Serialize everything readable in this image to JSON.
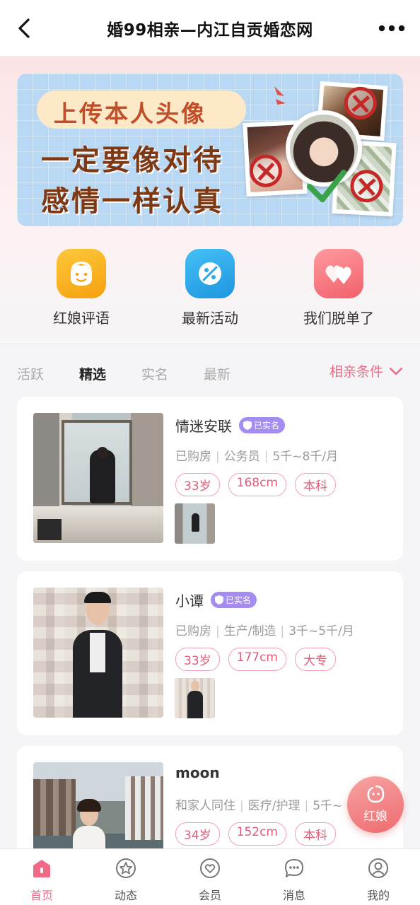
{
  "header": {
    "title": "婚99相亲—内江自贡婚恋网"
  },
  "banner": {
    "line1": "上传本人头像",
    "line2": "一定要像对待",
    "line3": "感情一样认真"
  },
  "quick_links": [
    {
      "label": "红娘评语",
      "icon": "matchmaker-face-icon",
      "color": "#f7b01a"
    },
    {
      "label": "最新活动",
      "icon": "activity-icon",
      "color": "#27a9ec"
    },
    {
      "label": "我们脱单了",
      "icon": "hearts-icon",
      "color": "#f56f7a"
    }
  ],
  "tabs": {
    "items": [
      "活跃",
      "精选",
      "实名",
      "最新"
    ],
    "active": "精选",
    "filter_label": "相亲条件"
  },
  "accent_color": "#ec6a86",
  "verified_label": "已实名",
  "profiles": [
    {
      "name": "情迷安联",
      "verified": true,
      "info": [
        "已购房",
        "公务员",
        "5千~8千/月"
      ],
      "tags": [
        "33岁",
        "168cm",
        "本科"
      ]
    },
    {
      "name": "小谭",
      "verified": true,
      "info": [
        "已购房",
        "生产/制造",
        "3千~5千/月"
      ],
      "tags": [
        "33岁",
        "177cm",
        "大专"
      ]
    },
    {
      "name": "moon",
      "verified": false,
      "info": [
        "和家人同住",
        "医疗/护理",
        "5千~"
      ],
      "tags": [
        "34岁",
        "152cm",
        "本科"
      ]
    }
  ],
  "float_button": {
    "label": "红娘"
  },
  "bottom_nav": [
    {
      "label": "首页",
      "icon": "home-icon",
      "active": true
    },
    {
      "label": "动态",
      "icon": "star-circle-icon",
      "active": false
    },
    {
      "label": "会员",
      "icon": "heart-circle-icon",
      "active": false
    },
    {
      "label": "消息",
      "icon": "chat-bubble-icon",
      "active": false
    },
    {
      "label": "我的",
      "icon": "user-circle-icon",
      "active": false
    }
  ]
}
